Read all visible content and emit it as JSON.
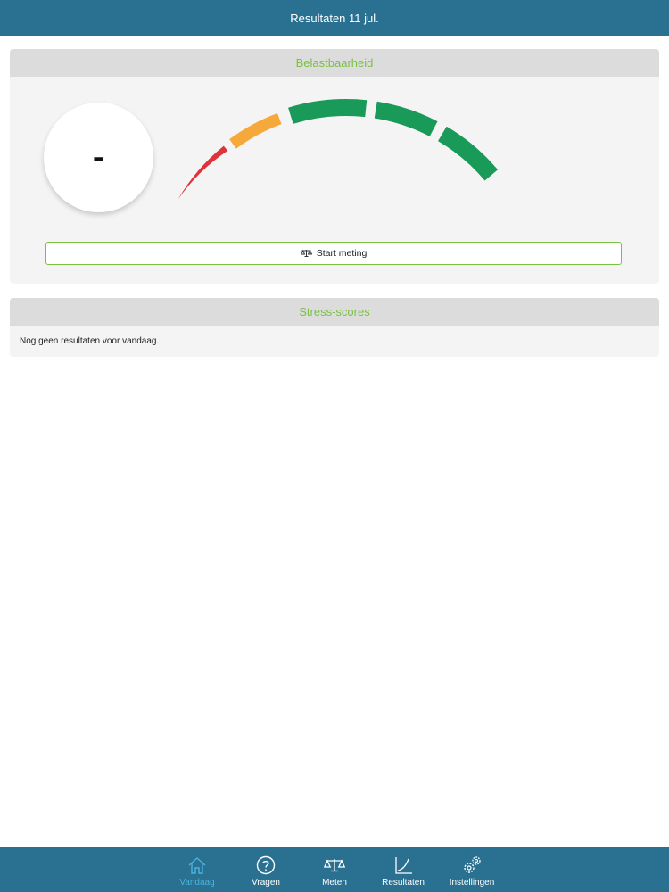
{
  "header": {
    "title": "Resultaten 11 jul."
  },
  "load_panel": {
    "title": "Belastbaarheid",
    "score": "-",
    "start_button_label": "Start meting",
    "gauge_colors": {
      "red": "#e0323a",
      "orange": "#f5a93a",
      "green": "#1a9a58"
    }
  },
  "stress_panel": {
    "title": "Stress-scores",
    "empty_text": "Nog geen resultaten voor vandaag."
  },
  "nav": {
    "items": [
      {
        "label": "Vandaag",
        "icon": "home-icon",
        "active": true
      },
      {
        "label": "Vragen",
        "icon": "question-icon"
      },
      {
        "label": "Meten",
        "icon": "scale-icon"
      },
      {
        "label": "Resultaten",
        "icon": "chart-icon"
      },
      {
        "label": "Instellingen",
        "icon": "gears-icon"
      }
    ],
    "active_color": "#4ab3e2"
  },
  "colors": {
    "bar": "#2a7090",
    "accent_green": "#7ac142"
  }
}
